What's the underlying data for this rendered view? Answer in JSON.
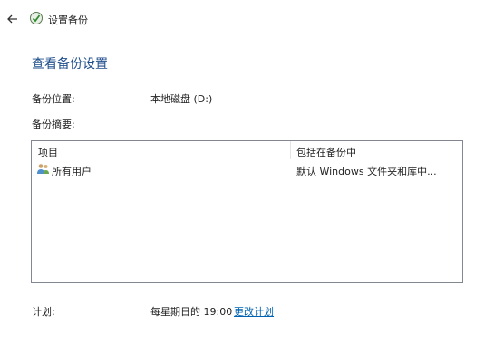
{
  "window": {
    "title": "设置备份"
  },
  "page": {
    "title": "查看备份设置"
  },
  "location": {
    "label": "备份位置:",
    "value": "本地磁盘 (D:)"
  },
  "summary": {
    "label": "备份摘要:",
    "columns": [
      "项目",
      "包括在备份中"
    ],
    "rows": [
      {
        "item": "所有用户",
        "included": "默认 Windows 文件夹和库中..."
      }
    ]
  },
  "schedule": {
    "label": "计划:",
    "value": "每星期日的 19:00",
    "change_link": "更改计划"
  },
  "icons": {
    "back": "back-arrow-icon",
    "app": "backup-icon",
    "row": "users-icon"
  }
}
